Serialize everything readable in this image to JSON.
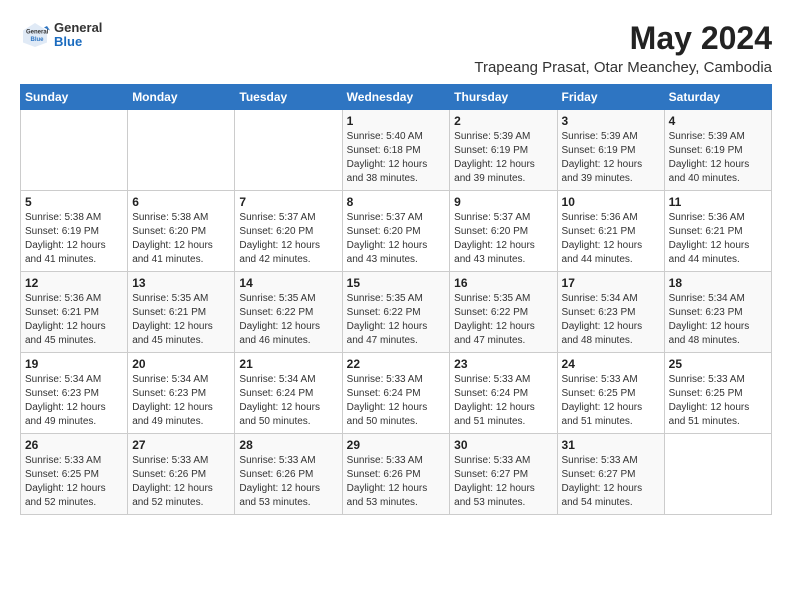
{
  "logo": {
    "general": "General",
    "blue": "Blue"
  },
  "title": {
    "month_year": "May 2024",
    "location": "Trapeang Prasat, Otar Meanchey, Cambodia"
  },
  "days_of_week": [
    "Sunday",
    "Monday",
    "Tuesday",
    "Wednesday",
    "Thursday",
    "Friday",
    "Saturday"
  ],
  "weeks": [
    {
      "days": [
        {
          "number": "",
          "details": ""
        },
        {
          "number": "",
          "details": ""
        },
        {
          "number": "",
          "details": ""
        },
        {
          "number": "1",
          "details": "Sunrise: 5:40 AM\nSunset: 6:18 PM\nDaylight: 12 hours\nand 38 minutes."
        },
        {
          "number": "2",
          "details": "Sunrise: 5:39 AM\nSunset: 6:19 PM\nDaylight: 12 hours\nand 39 minutes."
        },
        {
          "number": "3",
          "details": "Sunrise: 5:39 AM\nSunset: 6:19 PM\nDaylight: 12 hours\nand 39 minutes."
        },
        {
          "number": "4",
          "details": "Sunrise: 5:39 AM\nSunset: 6:19 PM\nDaylight: 12 hours\nand 40 minutes."
        }
      ]
    },
    {
      "days": [
        {
          "number": "5",
          "details": "Sunrise: 5:38 AM\nSunset: 6:19 PM\nDaylight: 12 hours\nand 41 minutes."
        },
        {
          "number": "6",
          "details": "Sunrise: 5:38 AM\nSunset: 6:20 PM\nDaylight: 12 hours\nand 41 minutes."
        },
        {
          "number": "7",
          "details": "Sunrise: 5:37 AM\nSunset: 6:20 PM\nDaylight: 12 hours\nand 42 minutes."
        },
        {
          "number": "8",
          "details": "Sunrise: 5:37 AM\nSunset: 6:20 PM\nDaylight: 12 hours\nand 43 minutes."
        },
        {
          "number": "9",
          "details": "Sunrise: 5:37 AM\nSunset: 6:20 PM\nDaylight: 12 hours\nand 43 minutes."
        },
        {
          "number": "10",
          "details": "Sunrise: 5:36 AM\nSunset: 6:21 PM\nDaylight: 12 hours\nand 44 minutes."
        },
        {
          "number": "11",
          "details": "Sunrise: 5:36 AM\nSunset: 6:21 PM\nDaylight: 12 hours\nand 44 minutes."
        }
      ]
    },
    {
      "days": [
        {
          "number": "12",
          "details": "Sunrise: 5:36 AM\nSunset: 6:21 PM\nDaylight: 12 hours\nand 45 minutes."
        },
        {
          "number": "13",
          "details": "Sunrise: 5:35 AM\nSunset: 6:21 PM\nDaylight: 12 hours\nand 45 minutes."
        },
        {
          "number": "14",
          "details": "Sunrise: 5:35 AM\nSunset: 6:22 PM\nDaylight: 12 hours\nand 46 minutes."
        },
        {
          "number": "15",
          "details": "Sunrise: 5:35 AM\nSunset: 6:22 PM\nDaylight: 12 hours\nand 47 minutes."
        },
        {
          "number": "16",
          "details": "Sunrise: 5:35 AM\nSunset: 6:22 PM\nDaylight: 12 hours\nand 47 minutes."
        },
        {
          "number": "17",
          "details": "Sunrise: 5:34 AM\nSunset: 6:23 PM\nDaylight: 12 hours\nand 48 minutes."
        },
        {
          "number": "18",
          "details": "Sunrise: 5:34 AM\nSunset: 6:23 PM\nDaylight: 12 hours\nand 48 minutes."
        }
      ]
    },
    {
      "days": [
        {
          "number": "19",
          "details": "Sunrise: 5:34 AM\nSunset: 6:23 PM\nDaylight: 12 hours\nand 49 minutes."
        },
        {
          "number": "20",
          "details": "Sunrise: 5:34 AM\nSunset: 6:23 PM\nDaylight: 12 hours\nand 49 minutes."
        },
        {
          "number": "21",
          "details": "Sunrise: 5:34 AM\nSunset: 6:24 PM\nDaylight: 12 hours\nand 50 minutes."
        },
        {
          "number": "22",
          "details": "Sunrise: 5:33 AM\nSunset: 6:24 PM\nDaylight: 12 hours\nand 50 minutes."
        },
        {
          "number": "23",
          "details": "Sunrise: 5:33 AM\nSunset: 6:24 PM\nDaylight: 12 hours\nand 51 minutes."
        },
        {
          "number": "24",
          "details": "Sunrise: 5:33 AM\nSunset: 6:25 PM\nDaylight: 12 hours\nand 51 minutes."
        },
        {
          "number": "25",
          "details": "Sunrise: 5:33 AM\nSunset: 6:25 PM\nDaylight: 12 hours\nand 51 minutes."
        }
      ]
    },
    {
      "days": [
        {
          "number": "26",
          "details": "Sunrise: 5:33 AM\nSunset: 6:25 PM\nDaylight: 12 hours\nand 52 minutes."
        },
        {
          "number": "27",
          "details": "Sunrise: 5:33 AM\nSunset: 6:26 PM\nDaylight: 12 hours\nand 52 minutes."
        },
        {
          "number": "28",
          "details": "Sunrise: 5:33 AM\nSunset: 6:26 PM\nDaylight: 12 hours\nand 53 minutes."
        },
        {
          "number": "29",
          "details": "Sunrise: 5:33 AM\nSunset: 6:26 PM\nDaylight: 12 hours\nand 53 minutes."
        },
        {
          "number": "30",
          "details": "Sunrise: 5:33 AM\nSunset: 6:27 PM\nDaylight: 12 hours\nand 53 minutes."
        },
        {
          "number": "31",
          "details": "Sunrise: 5:33 AM\nSunset: 6:27 PM\nDaylight: 12 hours\nand 54 minutes."
        },
        {
          "number": "",
          "details": ""
        }
      ]
    }
  ]
}
